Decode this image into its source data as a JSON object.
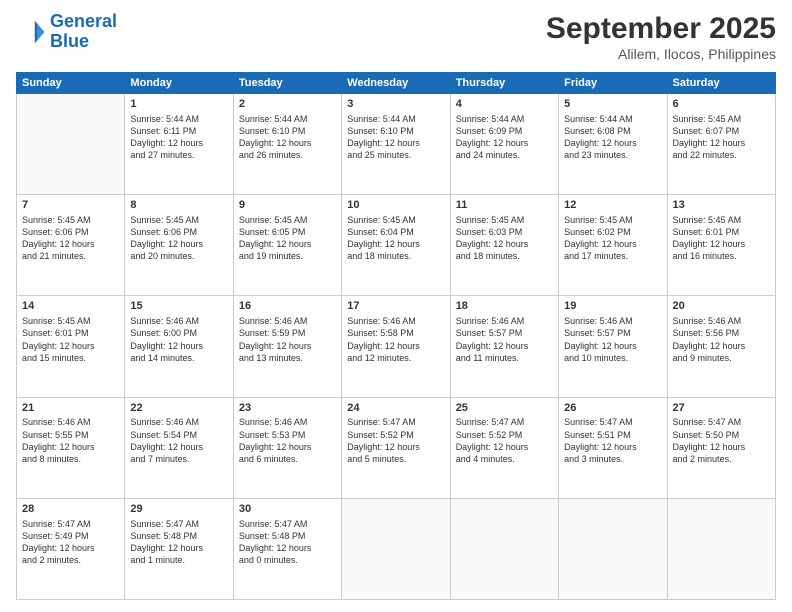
{
  "header": {
    "logo_line1": "General",
    "logo_line2": "Blue",
    "month": "September 2025",
    "location": "Alilem, Ilocos, Philippines"
  },
  "weekdays": [
    "Sunday",
    "Monday",
    "Tuesday",
    "Wednesday",
    "Thursday",
    "Friday",
    "Saturday"
  ],
  "weeks": [
    [
      {
        "day": "",
        "info": ""
      },
      {
        "day": "1",
        "info": "Sunrise: 5:44 AM\nSunset: 6:11 PM\nDaylight: 12 hours\nand 27 minutes."
      },
      {
        "day": "2",
        "info": "Sunrise: 5:44 AM\nSunset: 6:10 PM\nDaylight: 12 hours\nand 26 minutes."
      },
      {
        "day": "3",
        "info": "Sunrise: 5:44 AM\nSunset: 6:10 PM\nDaylight: 12 hours\nand 25 minutes."
      },
      {
        "day": "4",
        "info": "Sunrise: 5:44 AM\nSunset: 6:09 PM\nDaylight: 12 hours\nand 24 minutes."
      },
      {
        "day": "5",
        "info": "Sunrise: 5:44 AM\nSunset: 6:08 PM\nDaylight: 12 hours\nand 23 minutes."
      },
      {
        "day": "6",
        "info": "Sunrise: 5:45 AM\nSunset: 6:07 PM\nDaylight: 12 hours\nand 22 minutes."
      }
    ],
    [
      {
        "day": "7",
        "info": "Sunrise: 5:45 AM\nSunset: 6:06 PM\nDaylight: 12 hours\nand 21 minutes."
      },
      {
        "day": "8",
        "info": "Sunrise: 5:45 AM\nSunset: 6:06 PM\nDaylight: 12 hours\nand 20 minutes."
      },
      {
        "day": "9",
        "info": "Sunrise: 5:45 AM\nSunset: 6:05 PM\nDaylight: 12 hours\nand 19 minutes."
      },
      {
        "day": "10",
        "info": "Sunrise: 5:45 AM\nSunset: 6:04 PM\nDaylight: 12 hours\nand 18 minutes."
      },
      {
        "day": "11",
        "info": "Sunrise: 5:45 AM\nSunset: 6:03 PM\nDaylight: 12 hours\nand 18 minutes."
      },
      {
        "day": "12",
        "info": "Sunrise: 5:45 AM\nSunset: 6:02 PM\nDaylight: 12 hours\nand 17 minutes."
      },
      {
        "day": "13",
        "info": "Sunrise: 5:45 AM\nSunset: 6:01 PM\nDaylight: 12 hours\nand 16 minutes."
      }
    ],
    [
      {
        "day": "14",
        "info": "Sunrise: 5:45 AM\nSunset: 6:01 PM\nDaylight: 12 hours\nand 15 minutes."
      },
      {
        "day": "15",
        "info": "Sunrise: 5:46 AM\nSunset: 6:00 PM\nDaylight: 12 hours\nand 14 minutes."
      },
      {
        "day": "16",
        "info": "Sunrise: 5:46 AM\nSunset: 5:59 PM\nDaylight: 12 hours\nand 13 minutes."
      },
      {
        "day": "17",
        "info": "Sunrise: 5:46 AM\nSunset: 5:58 PM\nDaylight: 12 hours\nand 12 minutes."
      },
      {
        "day": "18",
        "info": "Sunrise: 5:46 AM\nSunset: 5:57 PM\nDaylight: 12 hours\nand 11 minutes."
      },
      {
        "day": "19",
        "info": "Sunrise: 5:46 AM\nSunset: 5:57 PM\nDaylight: 12 hours\nand 10 minutes."
      },
      {
        "day": "20",
        "info": "Sunrise: 5:46 AM\nSunset: 5:56 PM\nDaylight: 12 hours\nand 9 minutes."
      }
    ],
    [
      {
        "day": "21",
        "info": "Sunrise: 5:46 AM\nSunset: 5:55 PM\nDaylight: 12 hours\nand 8 minutes."
      },
      {
        "day": "22",
        "info": "Sunrise: 5:46 AM\nSunset: 5:54 PM\nDaylight: 12 hours\nand 7 minutes."
      },
      {
        "day": "23",
        "info": "Sunrise: 5:46 AM\nSunset: 5:53 PM\nDaylight: 12 hours\nand 6 minutes."
      },
      {
        "day": "24",
        "info": "Sunrise: 5:47 AM\nSunset: 5:52 PM\nDaylight: 12 hours\nand 5 minutes."
      },
      {
        "day": "25",
        "info": "Sunrise: 5:47 AM\nSunset: 5:52 PM\nDaylight: 12 hours\nand 4 minutes."
      },
      {
        "day": "26",
        "info": "Sunrise: 5:47 AM\nSunset: 5:51 PM\nDaylight: 12 hours\nand 3 minutes."
      },
      {
        "day": "27",
        "info": "Sunrise: 5:47 AM\nSunset: 5:50 PM\nDaylight: 12 hours\nand 2 minutes."
      }
    ],
    [
      {
        "day": "28",
        "info": "Sunrise: 5:47 AM\nSunset: 5:49 PM\nDaylight: 12 hours\nand 2 minutes."
      },
      {
        "day": "29",
        "info": "Sunrise: 5:47 AM\nSunset: 5:48 PM\nDaylight: 12 hours\nand 1 minute."
      },
      {
        "day": "30",
        "info": "Sunrise: 5:47 AM\nSunset: 5:48 PM\nDaylight: 12 hours\nand 0 minutes."
      },
      {
        "day": "",
        "info": ""
      },
      {
        "day": "",
        "info": ""
      },
      {
        "day": "",
        "info": ""
      },
      {
        "day": "",
        "info": ""
      }
    ]
  ]
}
